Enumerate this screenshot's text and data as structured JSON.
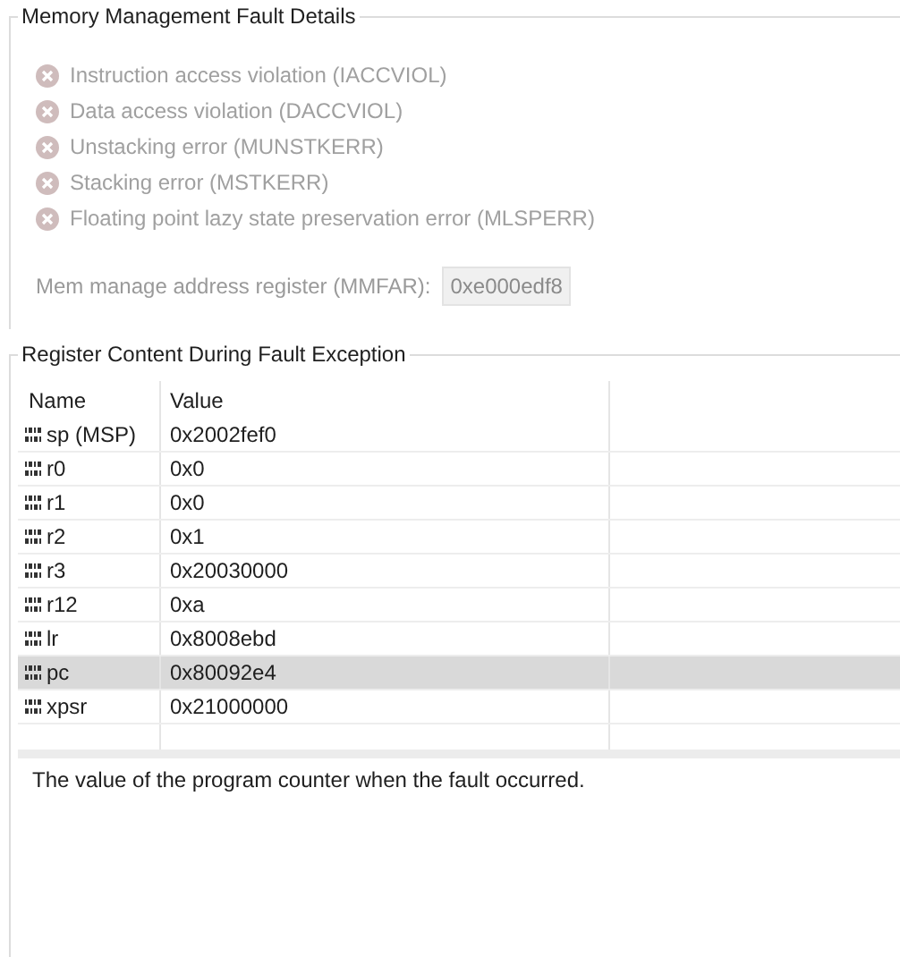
{
  "fault_details": {
    "title": "Memory Management Fault Details",
    "faults": [
      {
        "label": "Instruction access violation (IACCVIOL)",
        "active": false
      },
      {
        "label": "Data access violation (DACCVIOL)",
        "active": false
      },
      {
        "label": "Unstacking error (MUNSTKERR)",
        "active": false
      },
      {
        "label": "Stacking error (MSTKERR)",
        "active": false
      },
      {
        "label": "Floating point lazy state preservation error (MLSPERR)",
        "active": false
      }
    ],
    "address_label": "Mem manage address register (MMFAR):",
    "address_value": "0xe000edf8"
  },
  "registers": {
    "title": "Register Content During Fault Exception",
    "columns": [
      "Name",
      "Value"
    ],
    "rows": [
      {
        "name": "sp (MSP)",
        "value": "0x2002fef0",
        "selected": false
      },
      {
        "name": "r0",
        "value": "0x0",
        "selected": false
      },
      {
        "name": "r1",
        "value": "0x0",
        "selected": false
      },
      {
        "name": "r2",
        "value": "0x1",
        "selected": false
      },
      {
        "name": "r3",
        "value": "0x20030000",
        "selected": false
      },
      {
        "name": "r12",
        "value": "0xa",
        "selected": false
      },
      {
        "name": "lr",
        "value": "0x8008ebd",
        "selected": false
      },
      {
        "name": "pc",
        "value": "0x80092e4",
        "selected": true
      },
      {
        "name": "xpsr",
        "value": "0x21000000",
        "selected": false
      }
    ],
    "description": "The value of the program counter when the fault occurred."
  }
}
